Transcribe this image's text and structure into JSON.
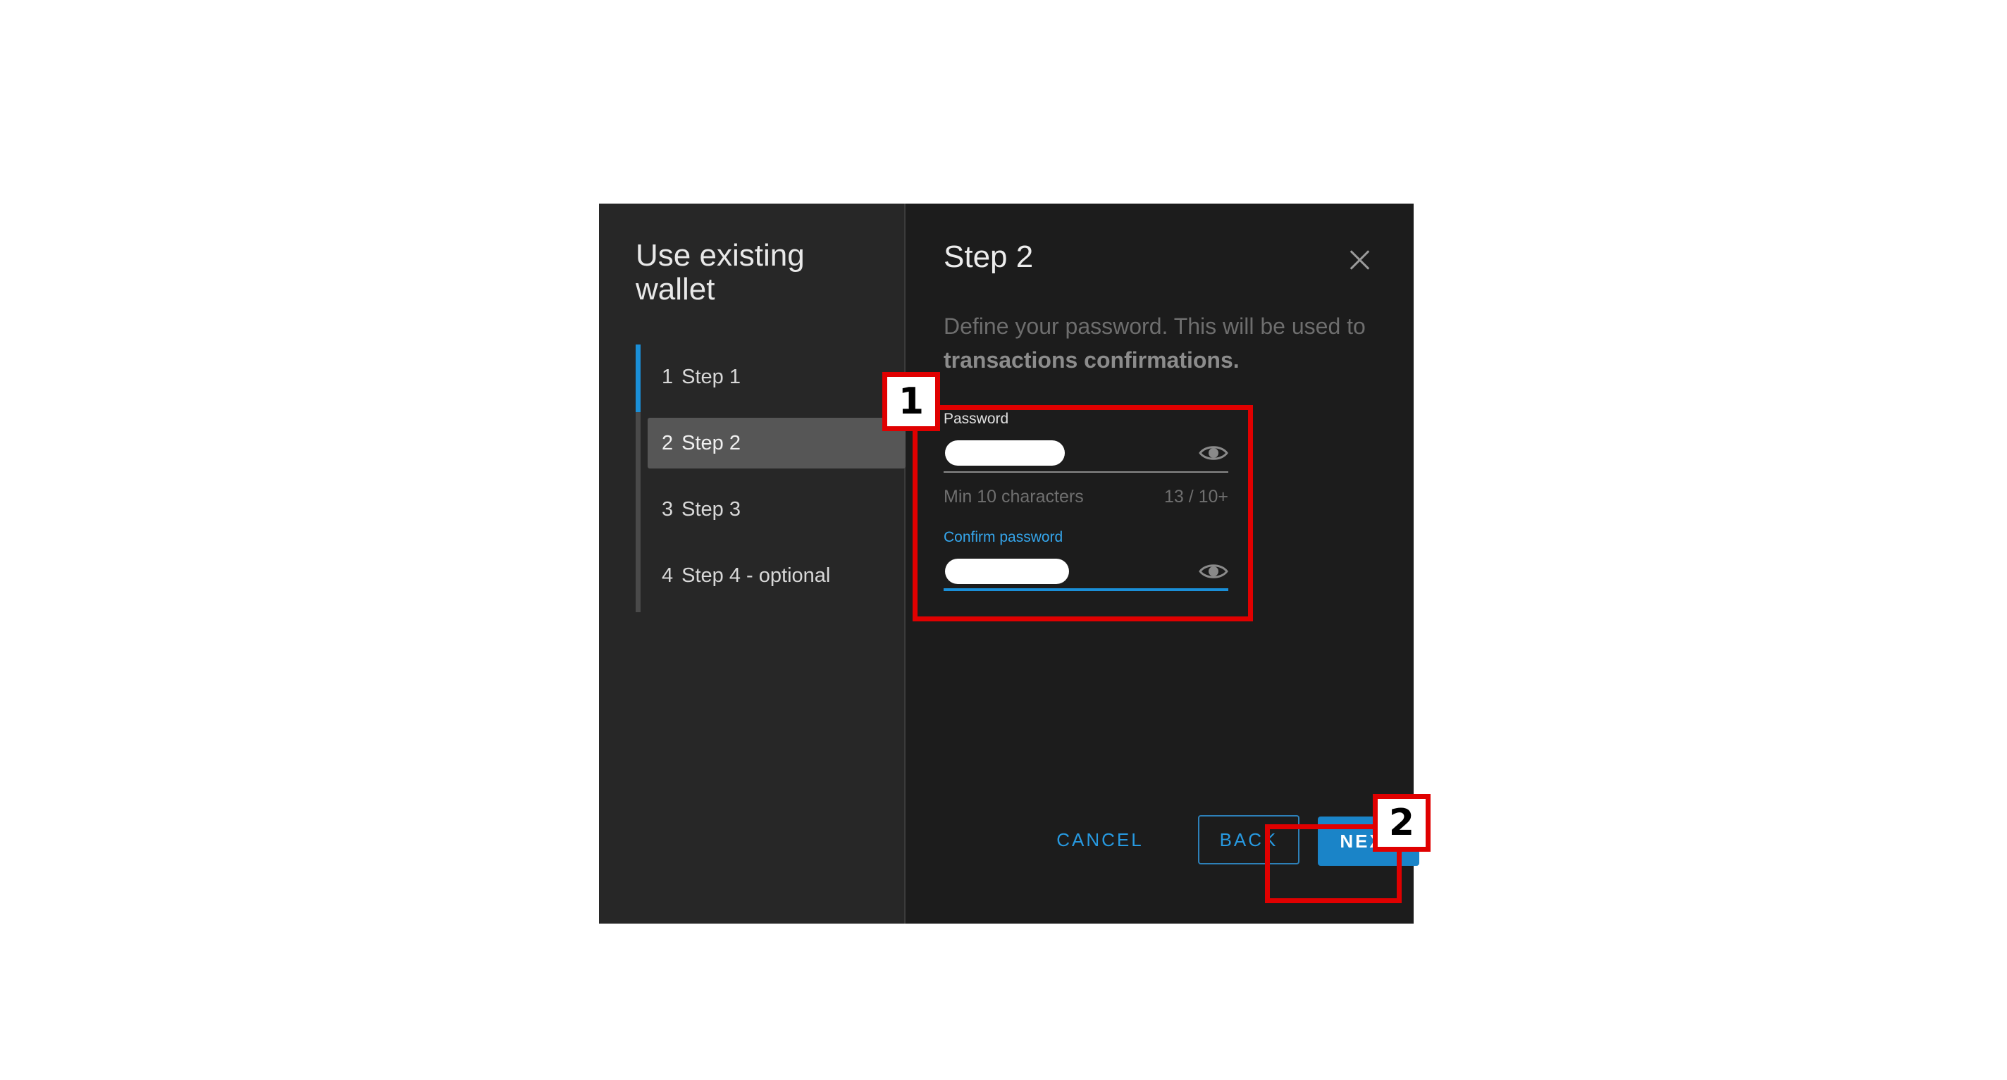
{
  "dialog": {
    "sidebar_title": "Use existing wallet",
    "steps": [
      {
        "number": "1",
        "label": "Step 1"
      },
      {
        "number": "2",
        "label": "Step 2"
      },
      {
        "number": "3",
        "label": "Step 3"
      },
      {
        "number": "4",
        "label": "Step 4 - optional"
      }
    ],
    "step_heading": "Step 2",
    "description_plain": "Define your password. This will be used to ",
    "description_bold": "transactions confirmations."
  },
  "form": {
    "password_label": "Password",
    "password_hint": "Min 10 characters",
    "password_counter": "13 / 10+",
    "confirm_label": "Confirm password"
  },
  "buttons": {
    "cancel": "CANCEL",
    "back": "BACK",
    "next": "NEXT"
  },
  "annotations": {
    "label_1": "1",
    "label_2": "2"
  },
  "colors": {
    "accent": "#1a8fd8",
    "annotation": "#e00000",
    "modal_bg": "#1c1c1c",
    "sidebar_bg": "#272727"
  },
  "icons": {
    "close": "close-icon",
    "eye": "eye-icon"
  }
}
